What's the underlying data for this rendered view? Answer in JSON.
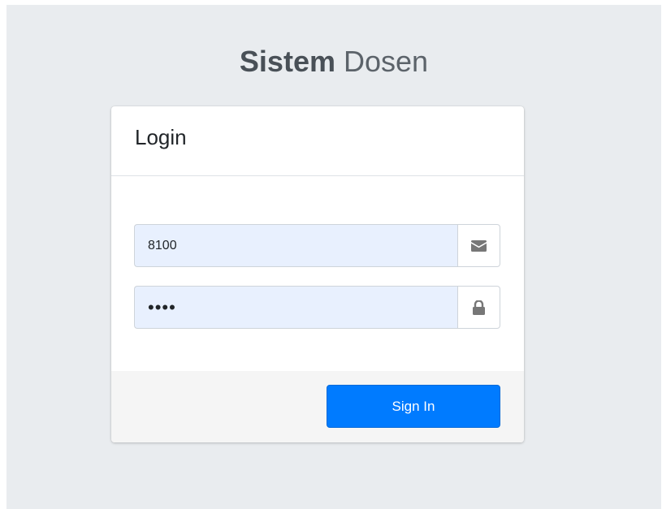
{
  "logo": {
    "bold": "Sistem",
    "light": "Dosen"
  },
  "card": {
    "title": "Login"
  },
  "form": {
    "username": {
      "value": "8100",
      "icon": "envelope-icon"
    },
    "password": {
      "value": "1234",
      "icon": "lock-icon"
    },
    "submit_label": "Sign In"
  },
  "colors": {
    "primary": "#007bff",
    "background": "#e9ecef",
    "autofill": "#e8f0fe",
    "icon": "#777777"
  }
}
